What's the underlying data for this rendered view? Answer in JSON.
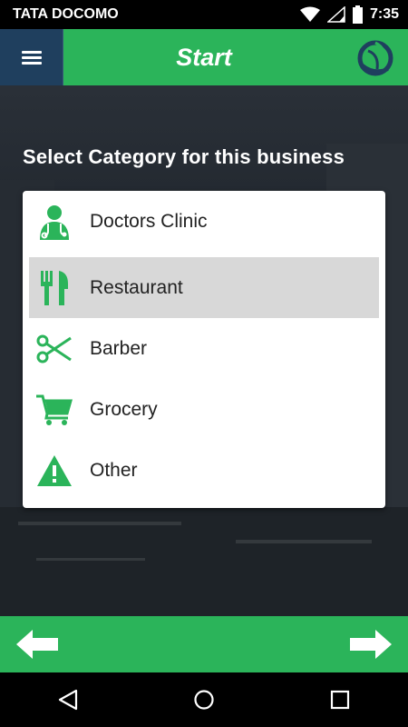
{
  "status_bar": {
    "carrier": "TATA DOCOMO",
    "time": "7:35"
  },
  "app_bar": {
    "title": "Start"
  },
  "screen": {
    "heading": "Select Category for this business",
    "categories": [
      {
        "label": "Doctors Clinic",
        "icon": "doctor-icon",
        "selected": false
      },
      {
        "label": "Restaurant",
        "icon": "fork-knife-icon",
        "selected": true
      },
      {
        "label": "Barber",
        "icon": "scissors-icon",
        "selected": false
      },
      {
        "label": "Grocery",
        "icon": "cart-icon",
        "selected": false
      },
      {
        "label": "Other",
        "icon": "warning-icon",
        "selected": false
      }
    ]
  },
  "colors": {
    "accent": "#2bb45a",
    "menu_bg": "#1f3f5e",
    "selected_bg": "#d8d8d8"
  }
}
